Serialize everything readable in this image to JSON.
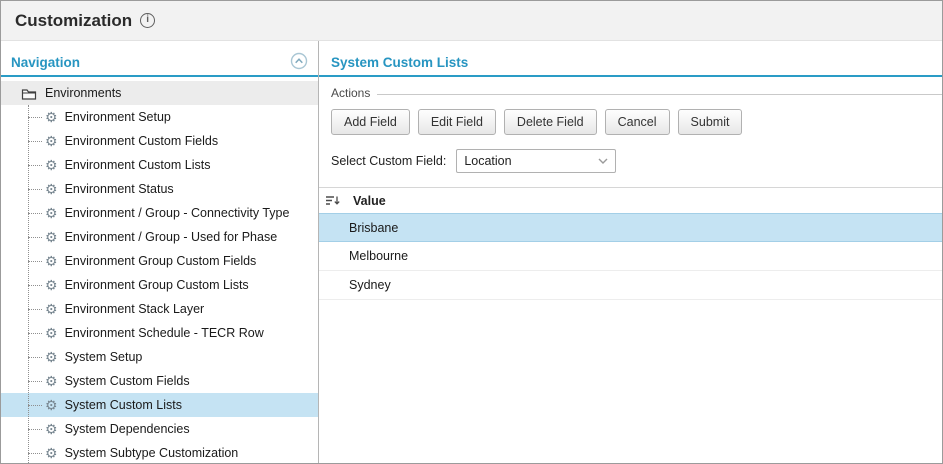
{
  "colors": {
    "accent": "#2795c1",
    "selection": "#c5e3f3"
  },
  "icons": {
    "gear": "⚙",
    "info": "i"
  },
  "header": {
    "title": "Customization"
  },
  "navigation": {
    "title": "Navigation",
    "root": {
      "label": "Environments"
    },
    "items": [
      {
        "label": "Environment Setup",
        "selected": false
      },
      {
        "label": "Environment Custom Fields",
        "selected": false
      },
      {
        "label": "Environment Custom Lists",
        "selected": false
      },
      {
        "label": "Environment Status",
        "selected": false
      },
      {
        "label": "Environment / Group - Connectivity Type",
        "selected": false
      },
      {
        "label": "Environment / Group - Used for Phase",
        "selected": false
      },
      {
        "label": "Environment Group Custom Fields",
        "selected": false
      },
      {
        "label": "Environment Group Custom Lists",
        "selected": false
      },
      {
        "label": "Environment Stack Layer",
        "selected": false
      },
      {
        "label": "Environment Schedule - TECR Row",
        "selected": false
      },
      {
        "label": "System Setup",
        "selected": false
      },
      {
        "label": "System Custom Fields",
        "selected": false
      },
      {
        "label": "System Custom Lists",
        "selected": true
      },
      {
        "label": "System Dependencies",
        "selected": false
      },
      {
        "label": "System Subtype Customization",
        "selected": false
      }
    ]
  },
  "main": {
    "title": "System Custom Lists",
    "actions": {
      "legend": "Actions",
      "buttons": [
        {
          "label": "Add Field"
        },
        {
          "label": "Edit Field"
        },
        {
          "label": "Delete Field"
        },
        {
          "label": "Cancel"
        },
        {
          "label": "Submit"
        }
      ],
      "select": {
        "label": "Select Custom Field:",
        "value": "Location"
      }
    },
    "table": {
      "columns": [
        {
          "label": "Value"
        }
      ],
      "rows": [
        {
          "value": "Brisbane",
          "selected": true
        },
        {
          "value": "Melbourne",
          "selected": false
        },
        {
          "value": "Sydney",
          "selected": false
        }
      ]
    }
  }
}
